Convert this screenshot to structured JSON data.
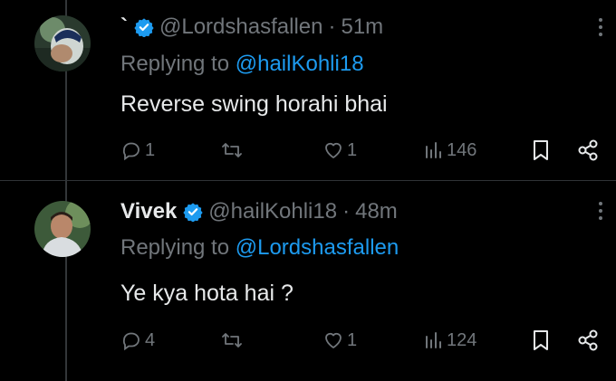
{
  "tweets": [
    {
      "display_name": "`",
      "handle": "@Lordshasfallen",
      "dot": "·",
      "time": "51m",
      "replying_prefix": "Replying to",
      "replying_to": "@hailKohli18",
      "text": "Reverse swing horahi bhai",
      "replies": "1",
      "retweets": "",
      "likes": "1",
      "views": "146"
    },
    {
      "display_name": "Vivek",
      "handle": "@hailKohli18",
      "dot": "·",
      "time": "48m",
      "replying_prefix": "Replying to",
      "replying_to": "@Lordshasfallen",
      "text": "Ye kya hota hai ?",
      "replies": "4",
      "retweets": "",
      "likes": "1",
      "views": "124"
    }
  ],
  "colors": {
    "background": "#000000",
    "text": "#e7e9ea",
    "muted": "#71767b",
    "link": "#1d9bf0",
    "verified": "#1d9bf0"
  },
  "icons": [
    "reply-icon",
    "retweet-icon",
    "heart-icon",
    "views-icon",
    "bookmark-icon",
    "share-icon",
    "verified-badge-icon",
    "more-icon"
  ]
}
